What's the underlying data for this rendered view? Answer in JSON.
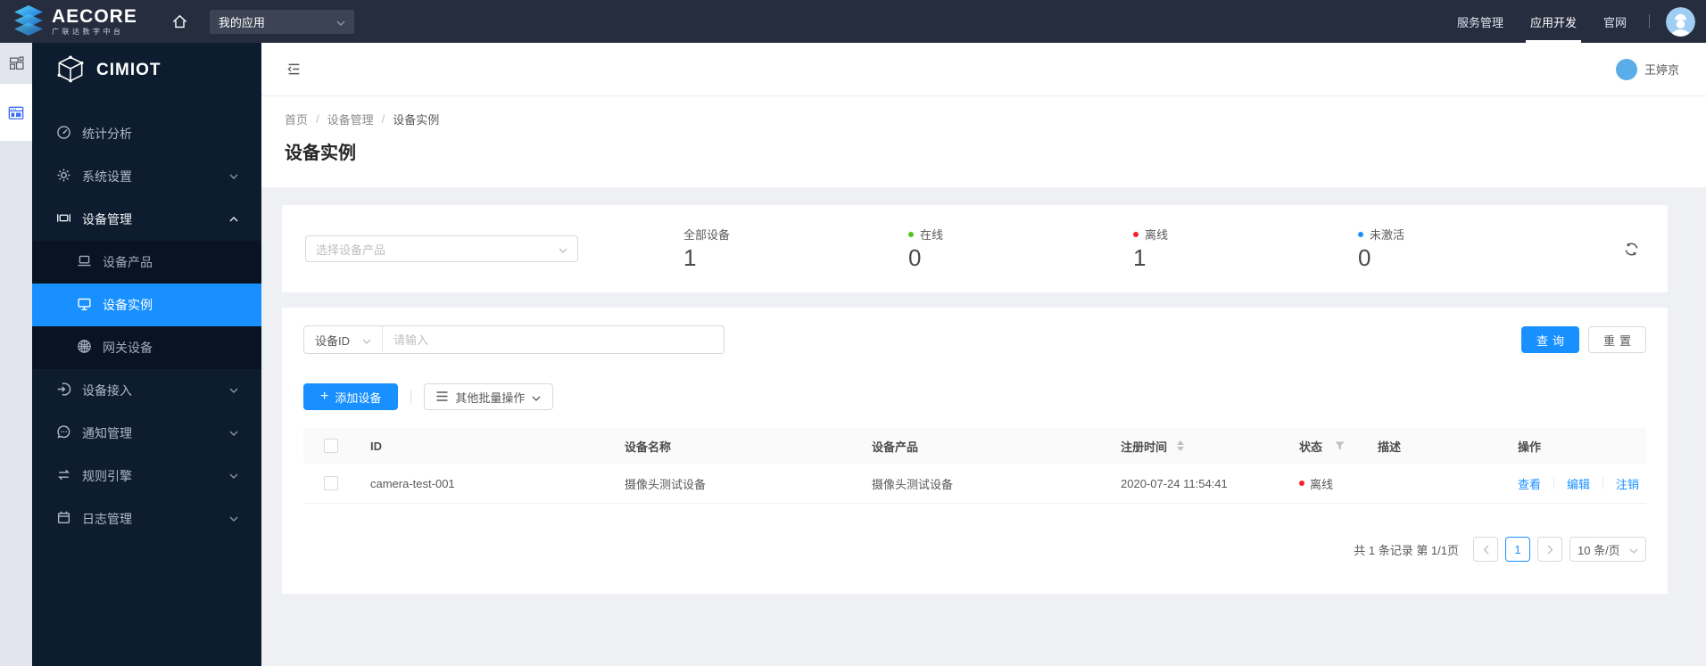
{
  "topbar": {
    "brand_name": "AECORE",
    "brand_subtitle": "广联达数字中台",
    "app_select_value": "我的应用",
    "nav": [
      {
        "label": "服务管理"
      },
      {
        "label": "应用开发"
      },
      {
        "label": "官网"
      }
    ]
  },
  "sidebar": {
    "product_name": "CIMIOT",
    "menu": [
      {
        "label": "统计分析"
      },
      {
        "label": "系统设置"
      },
      {
        "label": "设备管理",
        "submenu": [
          {
            "label": "设备产品"
          },
          {
            "label": "设备实例",
            "selected": true
          },
          {
            "label": "网关设备"
          }
        ]
      },
      {
        "label": "设备接入"
      },
      {
        "label": "通知管理"
      },
      {
        "label": "规则引擎"
      },
      {
        "label": "日志管理"
      }
    ]
  },
  "header": {
    "username": "王婷京"
  },
  "breadcrumb": {
    "items": [
      "首页",
      "设备管理",
      "设备实例"
    ]
  },
  "page": {
    "title": "设备实例"
  },
  "overview": {
    "product_select_placeholder": "选择设备产品",
    "stats": [
      {
        "label": "全部设备",
        "value": "1"
      },
      {
        "label": "在线",
        "value": "0",
        "dot_color": "#52c41a"
      },
      {
        "label": "离线",
        "value": "1",
        "dot_color": "#f5222d"
      },
      {
        "label": "未激活",
        "value": "0",
        "dot_color": "#1890ff"
      }
    ]
  },
  "query": {
    "field_select_value": "设备ID",
    "input_placeholder": "请输入",
    "search_label": "查询",
    "reset_label": "重置"
  },
  "toolbar": {
    "add_label": "添加设备",
    "batch_label": "其他批量操作"
  },
  "table": {
    "columns": [
      "ID",
      "设备名称",
      "设备产品",
      "注册时间",
      "状态",
      "描述",
      "操作"
    ],
    "rows": [
      {
        "id": "camera-test-001",
        "name": "摄像头测试设备",
        "product": "摄像头测试设备",
        "registered_at": "2020-07-24 11:54:41",
        "status": "离线",
        "status_color": "#f5222d",
        "description": "",
        "actions": [
          "查看",
          "编辑",
          "注销"
        ]
      }
    ]
  },
  "pagination": {
    "summary": "共 1 条记录 第 1/1页",
    "current_page": "1",
    "page_size": "10 条/页"
  },
  "colors": {
    "primary": "#1890ff",
    "online": "#52c41a",
    "offline": "#f5222d",
    "inactive": "#1890ff"
  }
}
